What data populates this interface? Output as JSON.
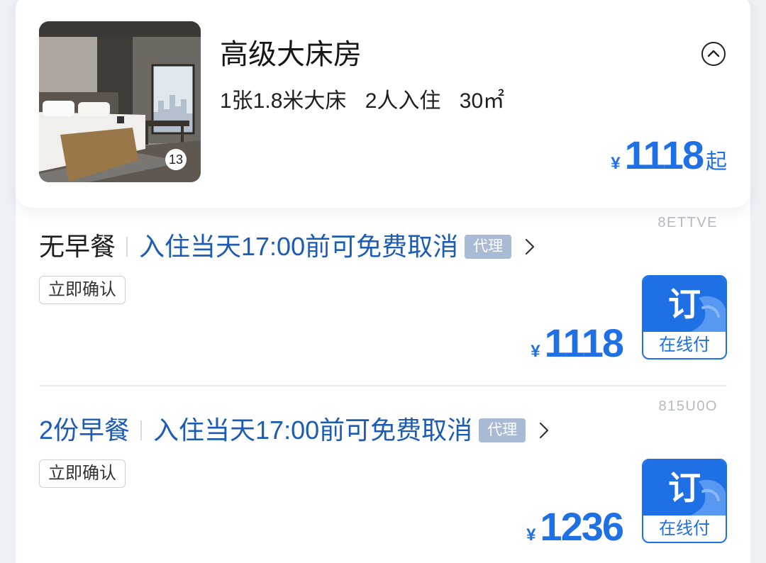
{
  "room": {
    "title": "高级大床房",
    "bed": "1张1.8米大床",
    "occupancy": "2人入住",
    "area": "30㎡",
    "photo_count": "13",
    "price": {
      "currency": "¥",
      "amount": "1118",
      "suffix": "起"
    }
  },
  "rates": [
    {
      "code": "8ETTVE",
      "meal": "无早餐",
      "meal_color": "#1e1e1e",
      "cancellation": "入住当天17:00前可免费取消",
      "tag": "代理",
      "confirm_tag": "立即确认",
      "price": {
        "currency": "¥",
        "amount": "1118"
      },
      "book": {
        "label": "订",
        "payment": "在线付"
      }
    },
    {
      "code": "815U0O",
      "meal": "2份早餐",
      "meal_color": "#1d5cb4",
      "cancellation": "入住当天17:00前可免费取消",
      "tag": "代理",
      "confirm_tag": "立即确认",
      "price": {
        "currency": "¥",
        "amount": "1236"
      },
      "book": {
        "label": "订",
        "payment": "在线付"
      }
    }
  ],
  "icons": {
    "collapse": "chevron-up-circle-icon",
    "detail": "chevron-right-icon",
    "book_decoration": "wave-icon"
  },
  "colors": {
    "background": "#edf0f5",
    "card": "#ffffff",
    "text_dark": "#1e1e1e",
    "price_blue": "#1f6fe5",
    "policy_blue": "#1d5cb4",
    "agent_tag": "#a9bad5",
    "code_gray": "#b6bac3",
    "wave_blue": "#5d9cf3"
  }
}
